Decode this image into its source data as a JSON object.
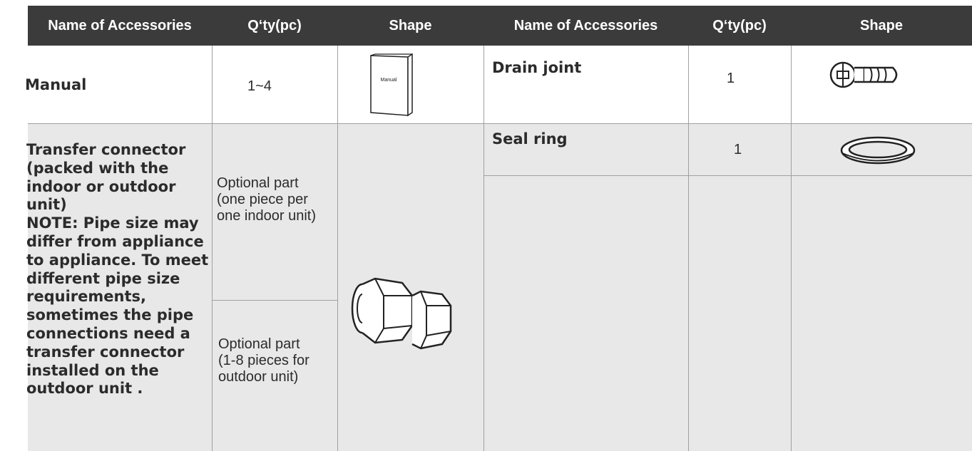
{
  "headers": [
    "Name of Accessories",
    "Q‘ty(pc)",
    "Shape",
    "Name of Accessories",
    "Q‘ty(pc)",
    "Shape"
  ],
  "rows": {
    "manual": {
      "name": "Manual",
      "qty": "1~4",
      "shape_label": "Manual",
      "shape_icon": "manual-booklet-icon"
    },
    "drain_joint": {
      "name": "Drain joint",
      "qty": "1",
      "shape_icon": "drain-joint-icon"
    },
    "seal_ring": {
      "name": "Seal ring",
      "qty": "1",
      "shape_icon": "seal-ring-icon"
    },
    "transfer_connector": {
      "name_lines": [
        "Transfer connector",
        "(packed with the",
        "indoor or outdoor",
        "unit)",
        "NOTE: Pipe size may",
        "differ from appliance",
        "to appliance. To meet",
        "different pipe size",
        "requirements,",
        "sometimes the pipe",
        "connections need a",
        "transfer connector",
        "installed on the",
        "outdoor unit ."
      ],
      "qty_indoor_lines": [
        "Optional part",
        "(one piece per",
        "one indoor unit)"
      ],
      "qty_outdoor_lines": [
        "Optional part",
        "(1-8 pieces for",
        "outdoor unit)"
      ],
      "shape_icon": "transfer-connector-icon"
    }
  },
  "colors": {
    "header_bg": "#3b3b3b",
    "header_text": "#ffffff",
    "row_gray": "#e8e8e9",
    "grid": "#a0a0a0"
  }
}
